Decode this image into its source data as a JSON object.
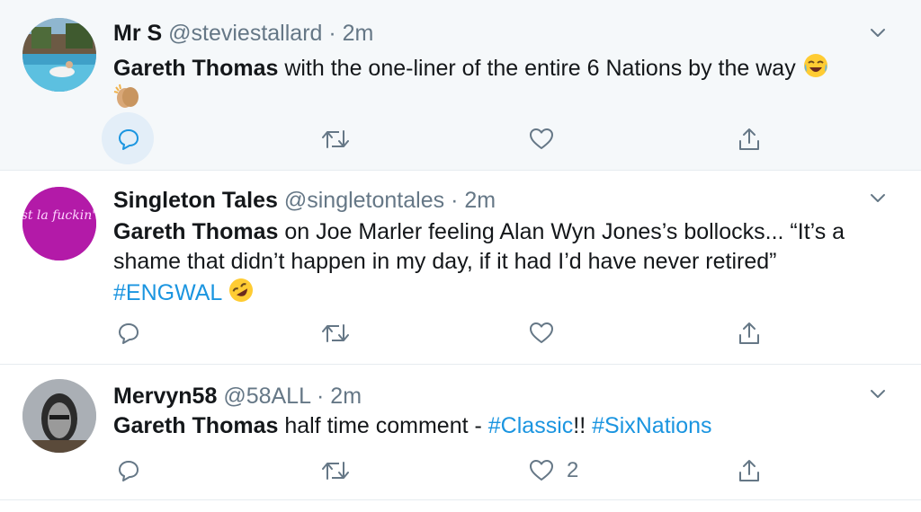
{
  "tweets": [
    {
      "name": "Mr S",
      "handle": "@steviestallard",
      "sep": "·",
      "time": "2m",
      "mention": "Gareth Thomas",
      "text": " with the one-liner of the entire 6 Nations by the way",
      "emoji_names": [
        "face-with-tears-of-joy-emoji",
        "clapping-hands-emoji"
      ],
      "likes": ""
    },
    {
      "name": "Singleton Tales",
      "handle": "@singletontales",
      "sep": "·",
      "time": "2m",
      "mention": "Gareth Thomas",
      "text": " on Joe Marler feeling Alan Wyn Jones’s bollocks... “It’s a shame that didn’t happen in my day, if it had I’d have never retired”",
      "hashtag": "#ENGWAL",
      "avatar_text": "C'est la fuckin' vie",
      "emoji_names": [
        "rolling-on-floor-laughing-emoji"
      ],
      "likes": ""
    },
    {
      "name": "Mervyn58",
      "handle": "@58ALL",
      "sep": "·",
      "time": "2m",
      "mention": "Gareth Thomas",
      "text": " half time comment - ",
      "hashtag1": "#Classic",
      "mid": "!! ",
      "hashtag2": "#SixNations",
      "likes": "2"
    }
  ],
  "colors": {
    "text": "#14171a",
    "muted": "#657786",
    "link": "#1b95e0",
    "hover_bg": "#f5f8fa",
    "divider": "#e6ecf0",
    "reply_highlight": "#e3eef8"
  },
  "icons": [
    "reply-icon",
    "retweet-icon",
    "like-icon",
    "share-icon",
    "chevron-down-icon"
  ]
}
